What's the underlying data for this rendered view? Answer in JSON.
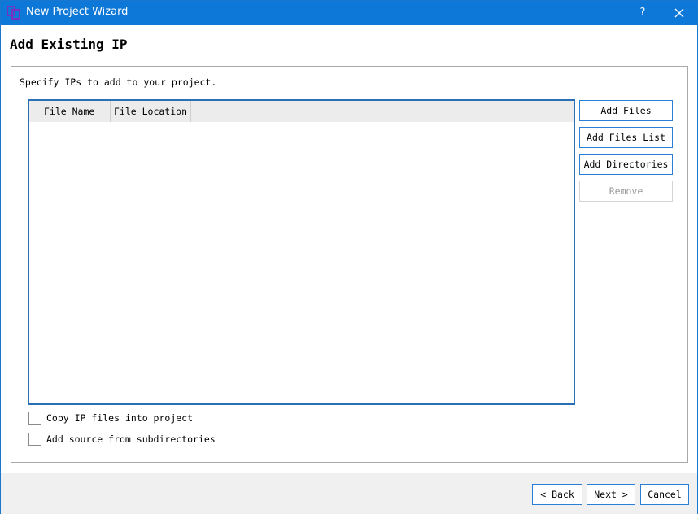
{
  "window": {
    "title": "New Project Wizard",
    "help_label": "?"
  },
  "page": {
    "title": "Add Existing IP",
    "instruction": "Specify IPs to add to your project."
  },
  "table": {
    "columns": [
      "File Name",
      "File Location"
    ],
    "rows": []
  },
  "side_buttons": {
    "add_files": "Add Files",
    "add_files_list": "Add Files List",
    "add_directories": "Add Directories",
    "remove": "Remove"
  },
  "options": {
    "copy_ip": "Copy IP files into project",
    "add_source": "Add source from subdirectories"
  },
  "footer": {
    "back": "< Back",
    "next": "Next >",
    "cancel": "Cancel"
  },
  "colors": {
    "titlebar": "#0d78d7",
    "accent_border": "#2a7fd4",
    "app_icon": "#7b2fbf"
  },
  "icons": {
    "app": "wizard-app-icon",
    "close": "close-icon"
  }
}
